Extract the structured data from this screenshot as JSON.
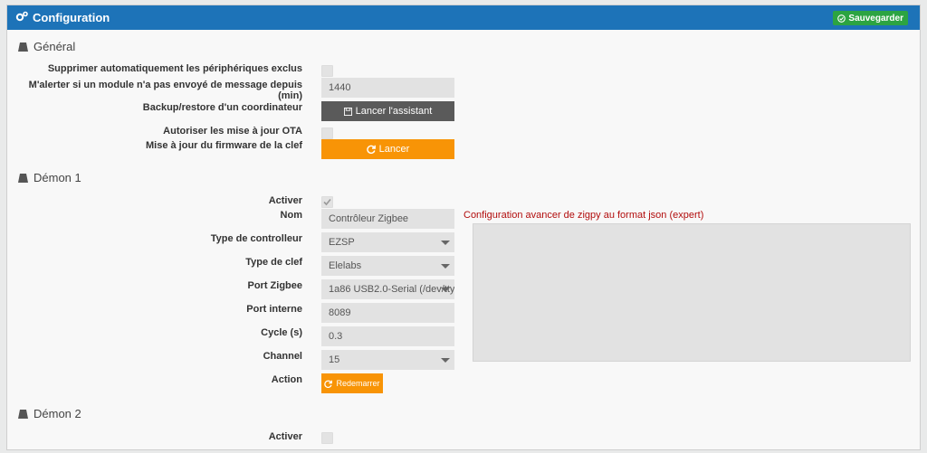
{
  "header": {
    "title": "Configuration",
    "save_label": "Sauvegarder"
  },
  "general": {
    "section_title": "Général",
    "exclude_label": "Supprimer automatiquement les périphériques exclus",
    "alert_label": "M'alerter si un module n'a pas envoyé de message depuis (min)",
    "alert_value": "1440",
    "backup_label": "Backup/restore d'un coordinateur",
    "backup_button": "Lancer l'assistant",
    "ota_label": "Autoriser les mise à jour OTA",
    "firmware_label": "Mise à jour du firmware de la clef",
    "firmware_button": "Lancer"
  },
  "demon1": {
    "section_title": "Démon 1",
    "enable_label": "Activer",
    "enabled": true,
    "name_label": "Nom",
    "name_value": "Contrôleur Zigbee",
    "controller_type_label": "Type de controlleur",
    "controller_type_value": "EZSP",
    "key_type_label": "Type de clef",
    "key_type_value": "Elelabs",
    "port_label": "Port Zigbee",
    "port_value": "1a86 USB2.0-Serial (/dev/tty",
    "internal_port_label": "Port interne",
    "internal_port_value": "8089",
    "cycle_label": "Cycle (s)",
    "cycle_value": "0.3",
    "channel_label": "Channel",
    "channel_value": "15",
    "action_label": "Action",
    "restart_button": "Redemarrer",
    "json_label": "Configuration avancer de zigpy au format json (expert)",
    "json_value": ""
  },
  "demon2": {
    "section_title": "Démon 2",
    "enable_label": "Activer",
    "enabled": false
  },
  "colors": {
    "header": "#1d73b8",
    "save": "#2ca442",
    "orange": "#f89406",
    "dark_button": "#5a5a5a",
    "json_label": "#b20d0d"
  }
}
